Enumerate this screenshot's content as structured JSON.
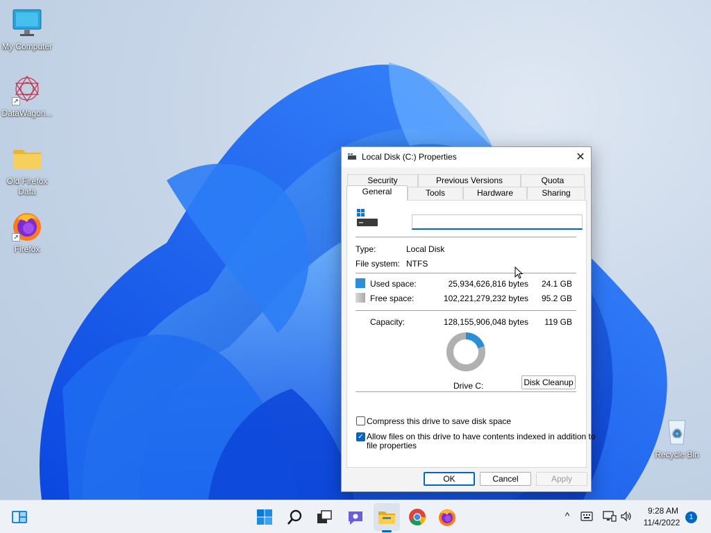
{
  "desktop": {
    "icons": [
      {
        "label": "My Computer",
        "icon": "monitor-icon"
      },
      {
        "label": "DataWagon...",
        "icon": "datawagon-icon"
      },
      {
        "label": "Old Firefox Data",
        "icon": "folder-icon"
      },
      {
        "label": "Firefox",
        "icon": "firefox-icon"
      },
      {
        "label": "Recycle Bin",
        "icon": "recycle-bin-icon"
      }
    ]
  },
  "dialog": {
    "title": "Local Disk (C:) Properties",
    "close_glyph": "✕",
    "tabs_back": [
      "Security",
      "Previous Versions",
      "Quota"
    ],
    "tabs_front": [
      "General",
      "Tools",
      "Hardware",
      "Sharing"
    ],
    "active_tab": "General",
    "name_value": "",
    "type_label": "Type:",
    "type_value": "Local Disk",
    "fs_label": "File system:",
    "fs_value": "NTFS",
    "used_label": "Used space:",
    "used_bytes": "25,934,626,816 bytes",
    "used_gb": "24.1 GB",
    "free_label": "Free space:",
    "free_bytes": "102,221,279,232 bytes",
    "free_gb": "95.2 GB",
    "capacity_label": "Capacity:",
    "capacity_bytes": "128,155,906,048 bytes",
    "capacity_gb": "119 GB",
    "used_fraction": 0.202,
    "drive_label": "Drive C:",
    "disk_cleanup": "Disk Cleanup",
    "compress_label": "Compress this drive to save disk space",
    "compress_checked": false,
    "index_label_1": "Allow files on this drive to have contents indexed in addition to",
    "index_label_2": "file properties",
    "index_checked": true,
    "ok": "OK",
    "cancel": "Cancel",
    "apply": "Apply",
    "colors": {
      "used": "#2a8fd6",
      "free": "#b0b0b0",
      "accent": "#0067c0"
    }
  },
  "taskbar": {
    "icons": [
      "widgets-icon",
      "start-icon",
      "search-icon",
      "task-view-icon",
      "chat-icon",
      "file-explorer-icon",
      "chrome-icon",
      "firefox-icon"
    ],
    "tray": {
      "chevron": "^",
      "time": "9:28 AM",
      "date": "11/4/2022",
      "notification_count": "1"
    }
  }
}
